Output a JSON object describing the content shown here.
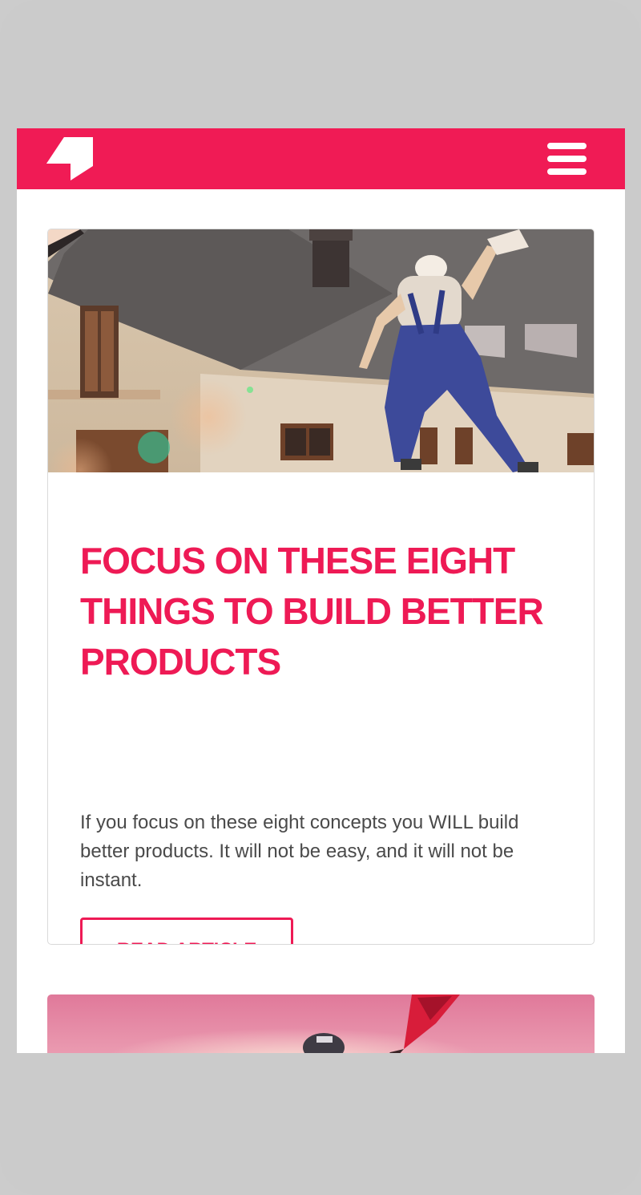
{
  "nav": {
    "logo_icon": "arrow-logo",
    "menu_icon": "hamburger-menu-icon",
    "color": "#f01b55"
  },
  "articles": [
    {
      "image": "construction-worker-jumping-in-front-of-house",
      "title": "FOCUS ON THESE EIGHT THINGS TO BUILD BETTER PRODUCTS",
      "excerpt": "If you focus on these eight concepts you WILL build better products. It will not be easy, and it will not be instant.",
      "button_label": "READ ARTICLE"
    },
    {
      "image": "person-with-red-paddle-at-sunset"
    }
  ],
  "colors": {
    "accent": "#ee1a55",
    "text": "#4a4a4a",
    "background": "#ffffff",
    "frame": "#cbcbcb"
  }
}
